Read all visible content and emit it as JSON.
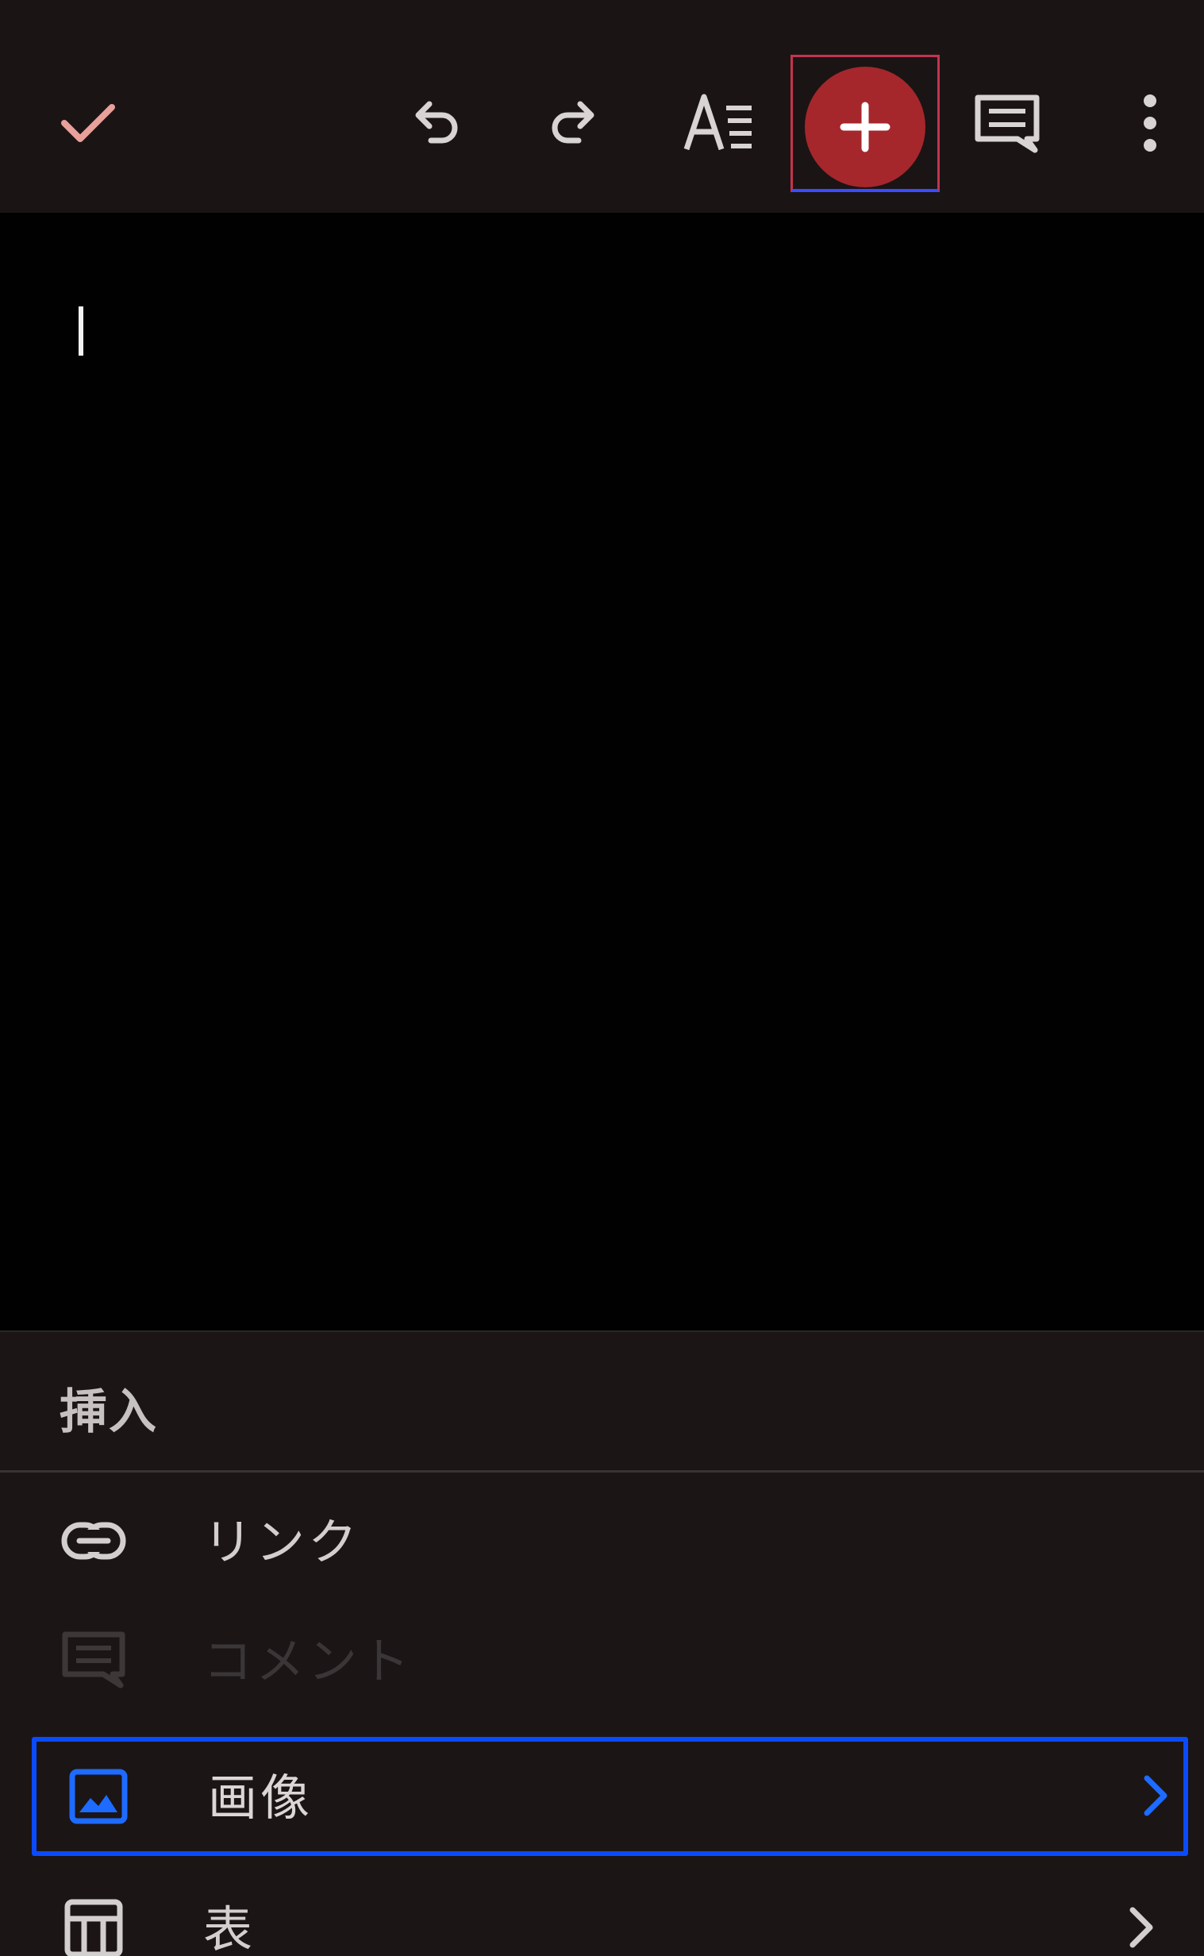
{
  "toolbar": {
    "items": [
      {
        "name": "check-icon",
        "color": "#e8a09a"
      },
      {
        "name": "undo-icon",
        "color": "#d9d4d4"
      },
      {
        "name": "redo-icon",
        "color": "#d9d4d4"
      },
      {
        "name": "text-format-icon",
        "color": "#d9d4d4"
      },
      {
        "name": "plus-icon",
        "color": "#ffffff",
        "background": "#a5272b"
      },
      {
        "name": "comment-icon",
        "color": "#d9d4d4"
      },
      {
        "name": "more-vert-icon",
        "color": "#d9d4d4"
      }
    ]
  },
  "sheet": {
    "title": "挿入",
    "items": [
      {
        "icon": "link-icon",
        "label": "リンク",
        "enabled": true,
        "has_submenu": false
      },
      {
        "icon": "comment-icon",
        "label": "コメント",
        "enabled": false,
        "has_submenu": false
      },
      {
        "icon": "image-icon",
        "label": "画像",
        "enabled": true,
        "has_submenu": true,
        "focused": true
      },
      {
        "icon": "table-icon",
        "label": "表",
        "enabled": true,
        "has_submenu": true
      }
    ]
  },
  "colors": {
    "toolbar_bg": "#1b1415",
    "canvas_bg": "#010101",
    "sheet_bg": "#1b1516",
    "focus_border": "#0a4bff",
    "accent_red": "#a5272b",
    "image_icon_blue": "#1e6bff"
  }
}
